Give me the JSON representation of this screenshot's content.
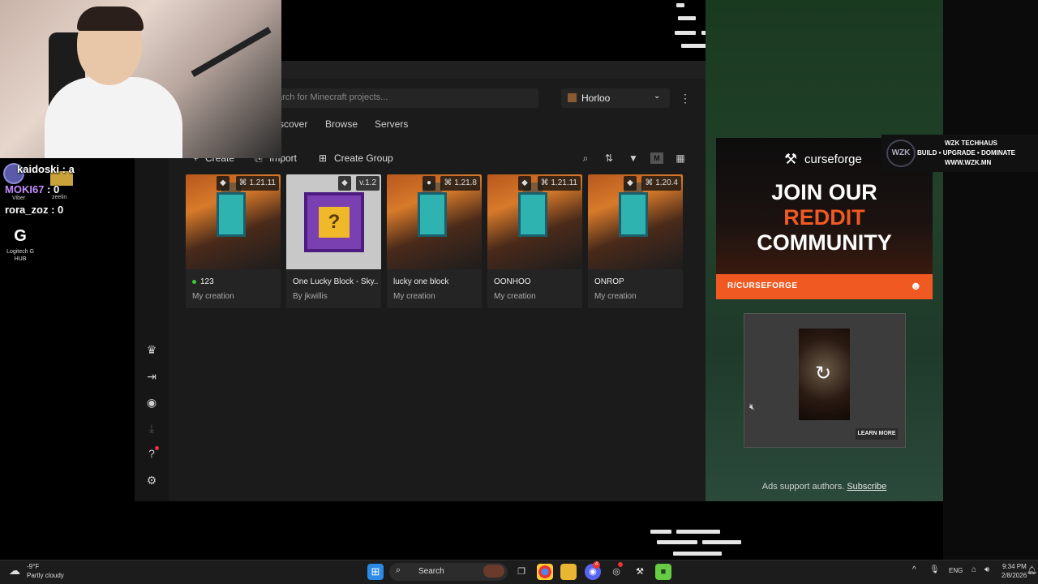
{
  "stream": {
    "chat": [
      {
        "user": "kaidoski",
        "msg": "a"
      },
      {
        "user": "MOKI67",
        "msg": "0"
      },
      {
        "user": "rora_zoz",
        "msg": "0"
      }
    ],
    "small_labels": [
      "Viber",
      "zeelin",
      "Logitech G HUB"
    ],
    "wzk": {
      "title": "WZK TECHHAUS",
      "tagline": "BUILD • UPGRADE • DOMINATE",
      "url": "WWW.WZK.MN"
    }
  },
  "app": {
    "search_placeholder": "arch for Minecraft projects...",
    "profile": "Horloo",
    "tabs": [
      "scover",
      "Browse",
      "Servers"
    ],
    "toolbar": {
      "create": "Create",
      "import": "Import",
      "create_group": "Create Group"
    },
    "toolbar_m": "M",
    "cards": [
      {
        "title": "123",
        "sub": "My creation",
        "version": "1.21.11",
        "thumb": "steve",
        "dot": true
      },
      {
        "title": "One Lucky Block - Sky...",
        "sub": "By jkwillis",
        "version": "v.1.2",
        "thumb": "lucky",
        "dot": false
      },
      {
        "title": "lucky one block",
        "sub": "My creation",
        "version": "1.21.8",
        "thumb": "steve",
        "dot": false
      },
      {
        "title": "OONHOO",
        "sub": "My creation",
        "version": "1.21.11",
        "thumb": "steve",
        "dot": false
      },
      {
        "title": "ONROP",
        "sub": "My creation",
        "version": "1.20.4",
        "thumb": "steve",
        "dot": false
      }
    ]
  },
  "ad": {
    "brand": "curseforge",
    "line1": "JOIN OUR",
    "line2": "REDDIT",
    "line3": "COMMUNITY",
    "subreddit": "R/CURSEFORGE",
    "learn_more": "LEARN MORE",
    "support_text": "Ads support authors.",
    "subscribe": "Subscribe"
  },
  "taskbar": {
    "weather_temp": "-9°F",
    "weather_desc": "Partly cloudy",
    "search": "Search",
    "lang": "ENG",
    "time": "9:34 PM",
    "date": "2/8/2026",
    "badge_count": "4"
  },
  "colors": {
    "accent": "#f05a22",
    "reddit_red": "#f05a22",
    "bg": "#1b1b1b"
  }
}
